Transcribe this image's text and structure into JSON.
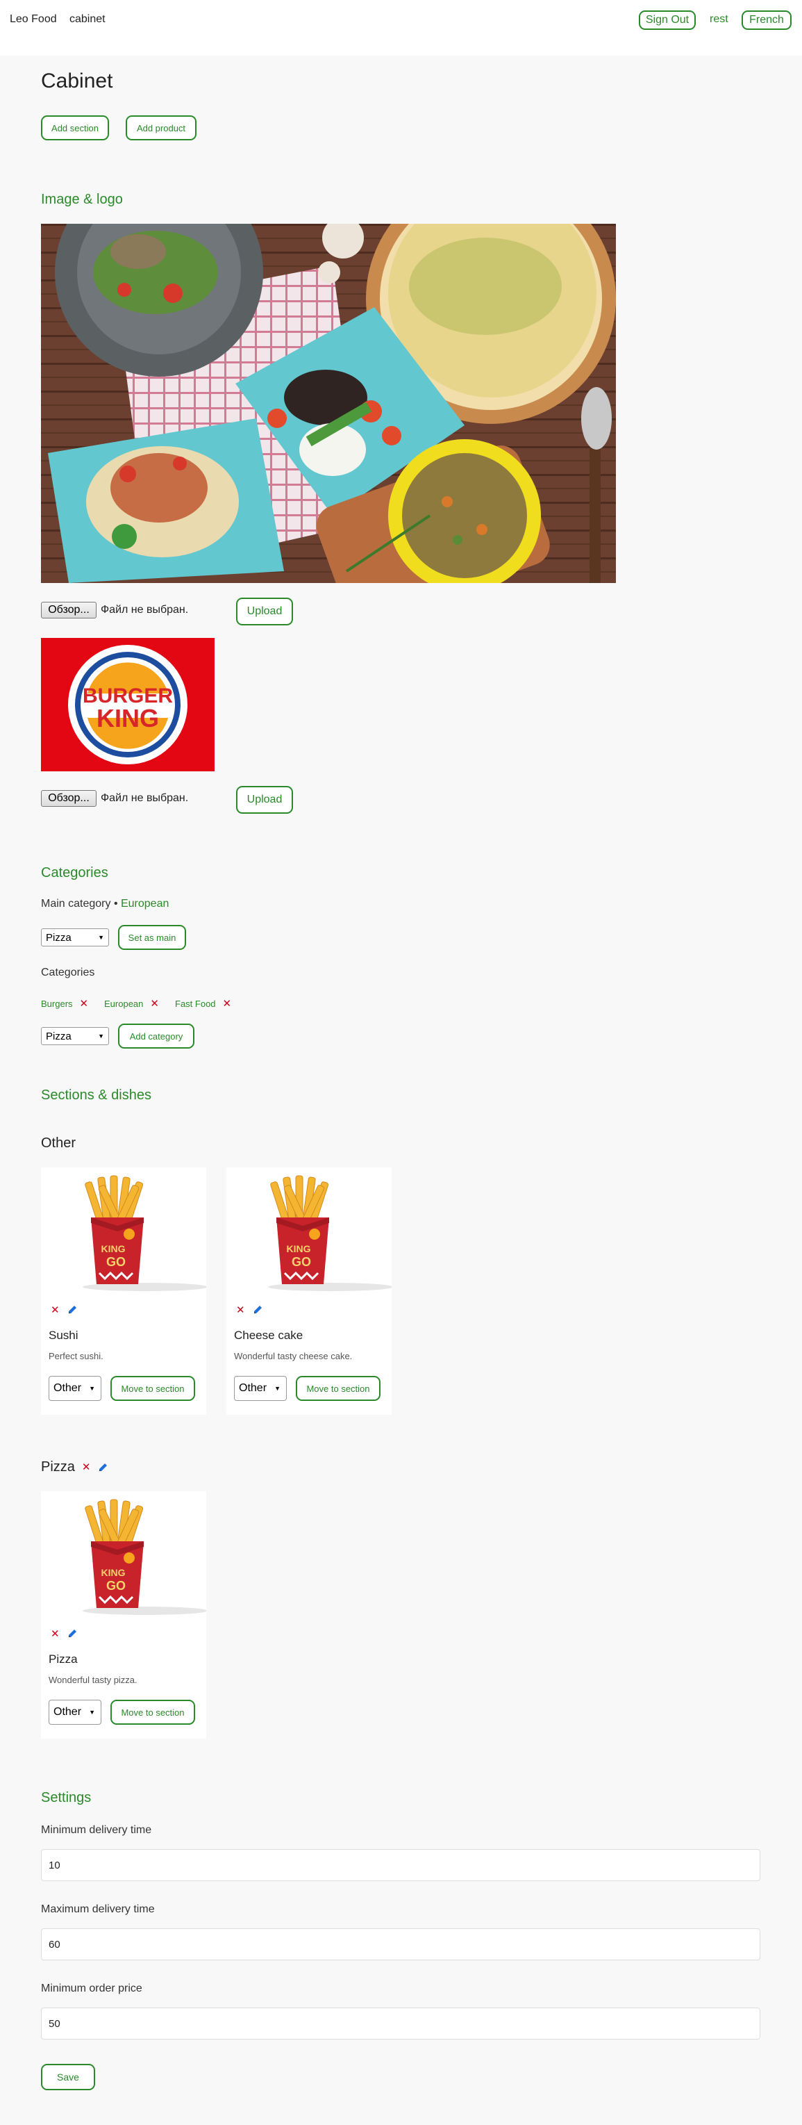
{
  "header": {
    "brand": "Leo Food",
    "nav_cabinet": "cabinet",
    "sign_out": "Sign Out",
    "nav_rest": "rest",
    "language": "French"
  },
  "page": {
    "title": "Cabinet",
    "add_section": "Add section",
    "add_product": "Add product"
  },
  "image_logo": {
    "heading": "Image & logo",
    "browse_label": "Обзор...",
    "no_file": "Файл не выбран.",
    "upload": "Upload",
    "logo_text_top": "BURGER",
    "logo_text_bottom": "KING"
  },
  "categories": {
    "heading": "Categories",
    "main_label": "Main category • ",
    "main_value": "European",
    "main_select": "Pizza",
    "set_main": "Set as main",
    "list_label": "Categories",
    "items": [
      "Burgers",
      "European",
      "Fast Food"
    ],
    "add_select": "Pizza",
    "add_category": "Add category"
  },
  "sections": {
    "heading": "Sections & dishes",
    "groups": [
      {
        "title": "Other",
        "dishes": [
          {
            "name": "Sushi",
            "description": "Perfect sushi.",
            "section": "Other",
            "move": "Move to section"
          },
          {
            "name": "Cheese cake",
            "description": "Wonderful tasty cheese cake.",
            "section": "Other",
            "move": "Move to section"
          }
        ]
      },
      {
        "title": "Pizza",
        "dishes": [
          {
            "name": "Pizza",
            "description": "Wonderful tasty pizza.",
            "section": "Other",
            "move": "Move to section"
          }
        ]
      }
    ],
    "box_text_top": "KING",
    "box_text_bottom": "GO"
  },
  "settings": {
    "heading": "Settings",
    "min_delivery_label": "Minimum delivery time",
    "min_delivery_value": "10",
    "max_delivery_label": "Maximum delivery time",
    "max_delivery_value": "60",
    "min_price_label": "Minimum order price",
    "min_price_value": "50",
    "save": "Save"
  },
  "colors": {
    "accent": "#2a8a2a",
    "delete": "#d0021b",
    "edit": "#1e6fd9",
    "background": "#f8f8f8"
  },
  "icons": [
    "close-icon",
    "pencil-icon",
    "chevron-down-icon"
  ]
}
